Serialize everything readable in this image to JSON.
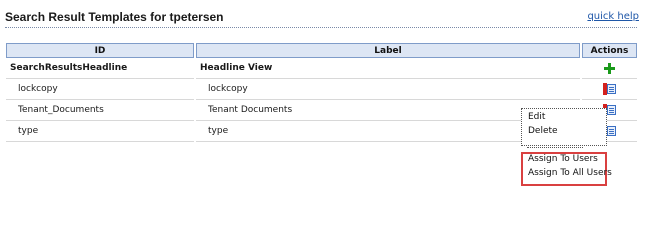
{
  "header": {
    "title": "Search Result Templates for tpetersen",
    "quick_help": "quick help"
  },
  "table": {
    "columns": [
      "ID",
      "Label",
      "Actions"
    ],
    "rows": [
      {
        "id": "SearchResultsHeadline",
        "label": "Headline View",
        "action_icon": "add-icon"
      },
      {
        "id": "lockcopy",
        "label": "lockcopy",
        "action_icon": "actions-menu-icon"
      },
      {
        "id": "Tenant_Documents",
        "label": "Tenant Documents",
        "action_icon": "actions-menu-icon"
      },
      {
        "id": "type",
        "label": "type",
        "action_icon": "actions-menu-icon"
      }
    ]
  },
  "context_menu": {
    "items": [
      "Edit",
      "Delete",
      "Assign To Users",
      "Assign To All Users"
    ],
    "highlight_color": "#d94040"
  },
  "colors": {
    "header_bg": "#dde6f4",
    "header_border": "#7f9cc9",
    "link": "#1f57a8"
  }
}
